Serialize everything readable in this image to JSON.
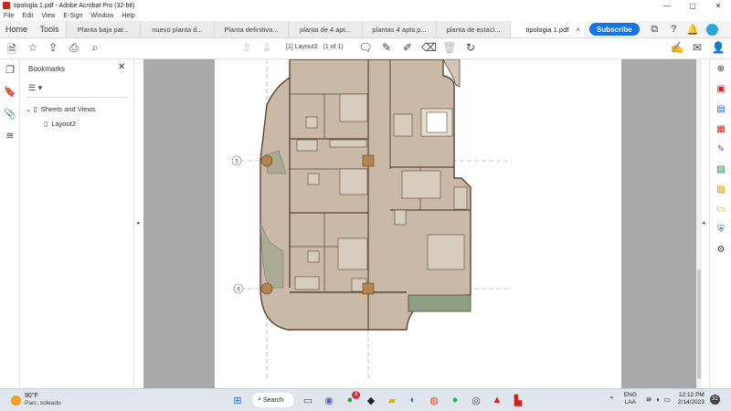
{
  "window": {
    "title": "tipologia 1.pdf - Adobe Acrobat Pro (32-bit)",
    "minimize": "—",
    "maximize": "▢",
    "close": "✕"
  },
  "menu": [
    "File",
    "Edit",
    "View",
    "E-Sign",
    "Window",
    "Help"
  ],
  "tabs": {
    "home": "Home",
    "tools": "Tools",
    "documents": [
      "Planta baja par...",
      "nuevo planta d...",
      "Planta definitiva...",
      "planta de 4 apt...",
      "plantas 4 apts.p...",
      "planta de estaci...",
      "tipologia 1.pdf"
    ],
    "close_icon": "×",
    "subscribe": "Subscribe"
  },
  "toolbar": {
    "page_label": "[1] Layout2",
    "page_count": "(1 of 1)"
  },
  "bookmarks": {
    "title": "Bookmarks",
    "close": "✕",
    "items": [
      "Sheets and Views",
      "Layout2"
    ]
  },
  "drawing": {
    "grid_labels": [
      "5",
      "6"
    ]
  },
  "taskbar": {
    "temperature": "90°F",
    "condition": "Parc. soleado",
    "search": "Search",
    "notification_count": "3",
    "lang_top": "ENG",
    "lang_bottom": "LAA",
    "time": "12:12 PM",
    "date": "2/14/2023",
    "notif_badge": "31"
  },
  "colors": {
    "accent": "#1473e6",
    "plan_fill": "#c9b9a6",
    "wall": "#5a4635",
    "accent_fill": "#b5834d"
  }
}
